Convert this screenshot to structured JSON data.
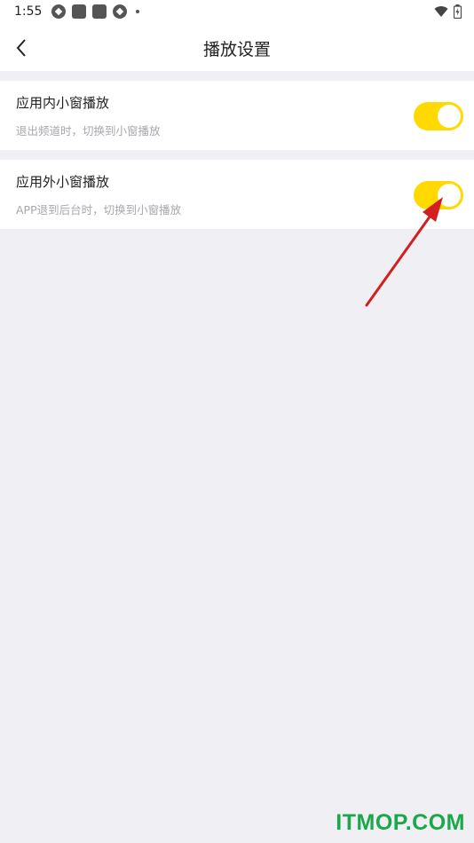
{
  "status_bar": {
    "time": "1:55"
  },
  "header": {
    "title": "播放设置",
    "back_icon": "chevron-left-icon"
  },
  "settings": [
    {
      "title": "应用内小窗播放",
      "description": "退出频道时，切换到小窗播放",
      "enabled": true
    },
    {
      "title": "应用外小窗播放",
      "description": "APP退到后台时，切换到小窗播放",
      "enabled": true
    }
  ],
  "watermark": "ITMOP.COM",
  "colors": {
    "toggle_on": "#ffd900",
    "background": "#efeff4",
    "arrow": "#d21f1f",
    "watermark": "#1aa84a"
  }
}
